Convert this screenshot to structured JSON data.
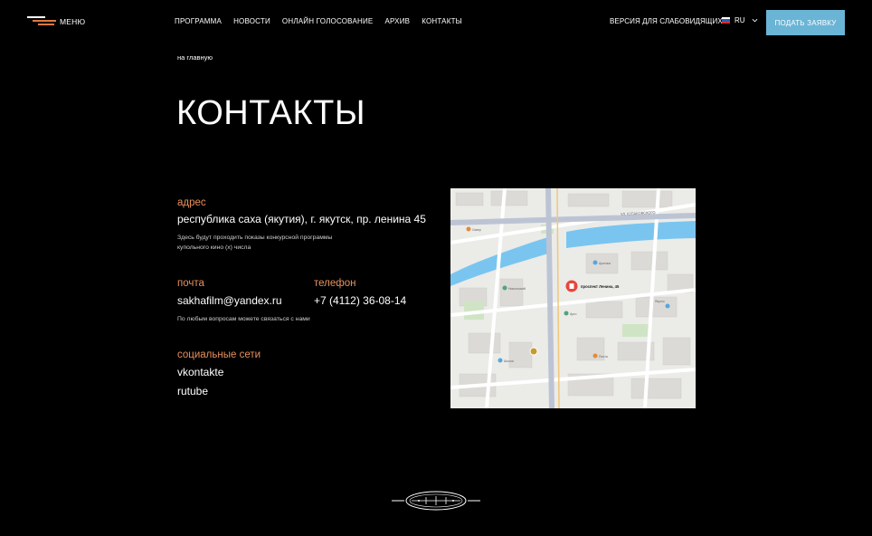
{
  "header": {
    "menu_label": "МЕНЮ",
    "nav": [
      "ПРОГРАММА",
      "НОВОСТИ",
      "ОНЛАЙН ГОЛОСОВАНИЕ",
      "АРХИВ",
      "КОНТАКТЫ"
    ],
    "vision_label": "ВЕРСИЯ ДЛЯ СЛАБОВИДЯЩИХ",
    "lang": "RU",
    "apply_label": "ПОДАТЬ ЗАЯВКУ",
    "apply_color": "#6ab4d6"
  },
  "breadcrumb": "на главную",
  "title": "КОНТАКТЫ",
  "address": {
    "label": "адрес",
    "value": "республика саха (якутия), г. якутск, пр. ленина 45",
    "note_line1": "Здесь будут проходить показы конкурсной программы",
    "note_line2": "купольного кино (х) числа"
  },
  "email": {
    "label": "почта",
    "value": "sakhafilm@yandex.ru"
  },
  "phone": {
    "label": "телефон",
    "value": "+7 (4112) 36-08-14"
  },
  "contact_note": "По любым вопросам можете связаться с нами",
  "social": {
    "label": "социальные сети",
    "links": [
      "vkontakte",
      "rutube"
    ]
  },
  "map": {
    "pin_label": "проспект Ленина, 45",
    "street_label": "УЛ. КУЛАКОВСКОГО",
    "place_labels": [
      "Арктика",
      "Никольский",
      "Арго",
      "Сквер",
      "Школа",
      "Почта",
      "Якутск"
    ]
  },
  "accent_color": "#e8915d"
}
